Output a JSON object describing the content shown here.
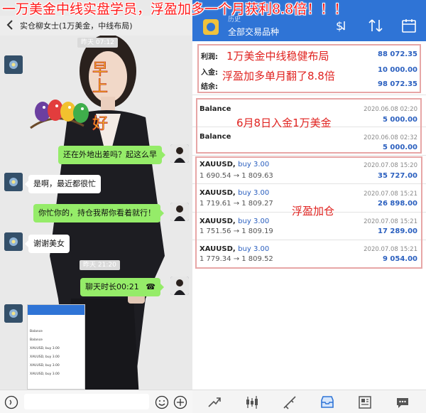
{
  "banner": {
    "text": "一万美金中线实盘学员，浮盈加多一个月获利8.8倍！！！"
  },
  "chat": {
    "title": "实仓柳女士(1万美金，中线布局)",
    "time_top": "昨天 07:12",
    "sticker_text": "早上好",
    "messages": [
      {
        "side": "me",
        "text": "还在外地出差吗？起这么早"
      },
      {
        "side": "other",
        "text": "是啊，最近都很忙"
      },
      {
        "side": "me",
        "text": "你忙你的，持仓我帮你看着就行！"
      },
      {
        "side": "other",
        "text": "谢谢美女"
      }
    ],
    "time_mid": "昨天 21:20",
    "call_text": "聊天时长00:21",
    "thumb": {
      "rows": [
        "Balance",
        "Balance",
        "XAUUSD, buy 3.00",
        "XAUUSD, buy 3.00",
        "XAUUSD, buy 3.00",
        "XAUUSD, buy 3.00"
      ]
    }
  },
  "app": {
    "header_sub": "历史",
    "header_title": "全部交易品种",
    "summary": [
      {
        "label": "利润:",
        "value": "88 072.35"
      },
      {
        "label": "入金:",
        "value": "10 000.00"
      },
      {
        "label": "结余:",
        "value": "98 072.35"
      }
    ],
    "balances": [
      {
        "label": "Balance",
        "date": "2020.06.08 02:20",
        "amount": "5 000.00"
      },
      {
        "label": "Balance",
        "date": "2020.06.08 02:32",
        "amount": "5 000.00"
      }
    ],
    "trades": [
      {
        "symbol": "XAUUSD,",
        "type": "buy 3.00",
        "prices": "1 690.54 → 1 809.63",
        "date": "2020.07.08 15:20",
        "profit": "35 727.00"
      },
      {
        "symbol": "XAUUSD,",
        "type": "buy 3.00",
        "prices": "1 719.61 → 1 809.27",
        "date": "2020.07.08 15:21",
        "profit": "26 898.00"
      },
      {
        "symbol": "XAUUSD,",
        "type": "buy 3.00",
        "prices": "1 751.56 → 1 809.19",
        "date": "2020.07.08 15:21",
        "profit": "17 289.00"
      },
      {
        "symbol": "XAUUSD,",
        "type": "buy 3.00",
        "prices": "1 779.34 → 1 809.52",
        "date": "2020.07.08 15:21",
        "profit": "9 054.00"
      }
    ],
    "notes": {
      "summary": "1万美金中线稳健布局",
      "summary2": "浮盈加多单月翻了8.8倍",
      "deposit": "6月8日入金1万美金",
      "add": "浮盈加仓"
    },
    "tabs": [
      "quotes-icon",
      "chart-icon",
      "trade-icon",
      "history-icon",
      "news-icon",
      "chat-icon"
    ]
  },
  "colors": {
    "accent": "#2f74d6",
    "note_red": "#e0221f",
    "bubble_green": "#95ec69",
    "value_blue": "#2a5fbf"
  }
}
